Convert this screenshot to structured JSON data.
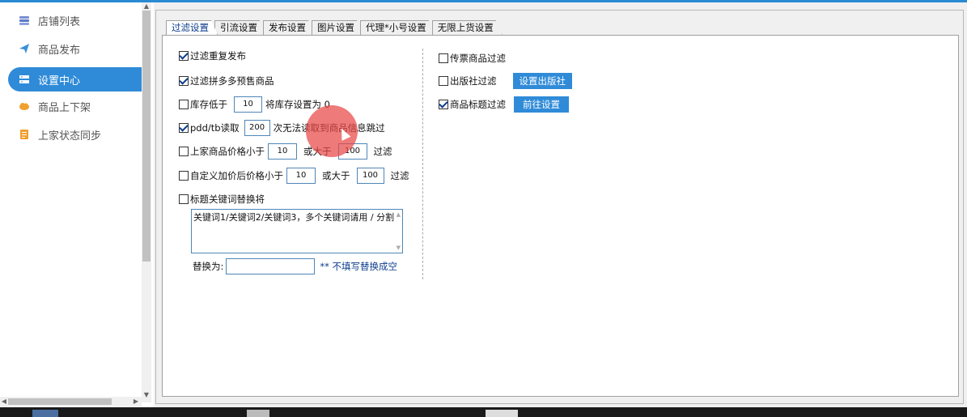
{
  "sidebar": {
    "items": [
      {
        "label": "店铺列表",
        "icon": "stack-icon",
        "active": false
      },
      {
        "label": "商品发布",
        "icon": "paper-plane-icon",
        "active": false
      },
      {
        "label": "设置中心",
        "icon": "server-icon",
        "active": true
      },
      {
        "label": "商品上下架",
        "icon": "cloud-icon",
        "active": false
      },
      {
        "label": "上家状态同步",
        "icon": "document-icon",
        "active": false
      }
    ]
  },
  "tabs": [
    "过滤设置",
    "引流设置",
    "发布设置",
    "图片设置",
    "代理*小号设置",
    "无限上货设置"
  ],
  "left": {
    "filter_repeat": {
      "label": "过滤重复发布",
      "checked": true
    },
    "filter_pdd_presale": {
      "label": "过滤拼多多预售商品",
      "checked": true
    },
    "stock": {
      "label": "库存低于",
      "value": "10",
      "suffix": "将库存设置为 0",
      "checked": false
    },
    "pdd_tb_read": {
      "label": "pdd/tb读取",
      "value": "200",
      "suffix": "次无法读取到商品信息跳过",
      "checked": true
    },
    "price": {
      "label": "上家商品价格小于",
      "min": "10",
      "mid": "或大于",
      "max": "100",
      "suffix": "过滤",
      "checked": false
    },
    "custom_price": {
      "label": "自定义加价后价格小于",
      "min": "10",
      "mid": "或大于",
      "max": "100",
      "suffix": "过滤",
      "checked": false
    },
    "title_keyword": {
      "label": "标题关键词替换将",
      "checked": false,
      "textarea": "关键词1/关键词2/关键词3，多个关键词请用  / 分割"
    },
    "replace": {
      "label": "替换为:",
      "value": "",
      "hint": "** 不填写替换成空"
    }
  },
  "right": {
    "ticket_filter": {
      "label": "传票商品过滤",
      "checked": false
    },
    "publisher_filter": {
      "label": "出版社过滤",
      "checked": false,
      "button": "设置出版社"
    },
    "title_filter": {
      "label": "商品标题过滤",
      "checked": true,
      "button": "前往设置"
    }
  },
  "colors": {
    "accent": "#2f8bd8",
    "link_blue": "#0b3c8c",
    "cursor_highlight": "#e84646"
  }
}
